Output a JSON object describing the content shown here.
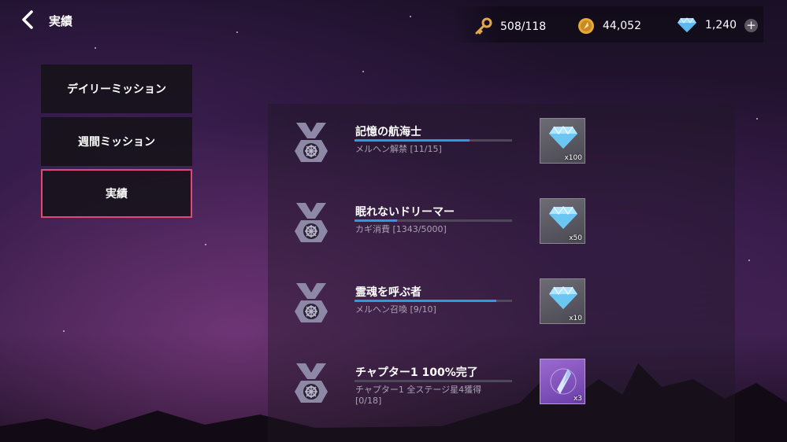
{
  "header": {
    "title": "実績",
    "currencies": {
      "keys": "508/118",
      "gold": "44,052",
      "gems": "1,240"
    }
  },
  "tabs": [
    {
      "label": "デイリーミッション",
      "selected": false
    },
    {
      "label": "週間ミッション",
      "selected": false
    },
    {
      "label": "実績",
      "selected": true
    }
  ],
  "achievements": [
    {
      "title": "記憶の航海士",
      "subtitle": "メルヘン解禁 [11/15]",
      "progress": 0.73,
      "reward_icon": "diamond-icon",
      "reward_qty": "x100"
    },
    {
      "title": "眠れないドリーマー",
      "subtitle": "カギ消費 [1343/5000]",
      "progress": 0.27,
      "reward_icon": "diamond-icon",
      "reward_qty": "x50"
    },
    {
      "title": "霊魂を呼ぶ者",
      "subtitle": "メルヘン召喚 [9/10]",
      "progress": 0.9,
      "reward_icon": "diamond-icon",
      "reward_qty": "x10"
    },
    {
      "title": "チャプター1 100%完了",
      "subtitle": "チャプター1 全ステージ星4獲得",
      "subtitle2": "[0/18]",
      "progress": 0,
      "reward_icon": "crystal-shard-icon",
      "reward_qty": "x3"
    }
  ],
  "colors": {
    "accent_selected": "#e04a72",
    "progress": "#2a9bdf"
  }
}
